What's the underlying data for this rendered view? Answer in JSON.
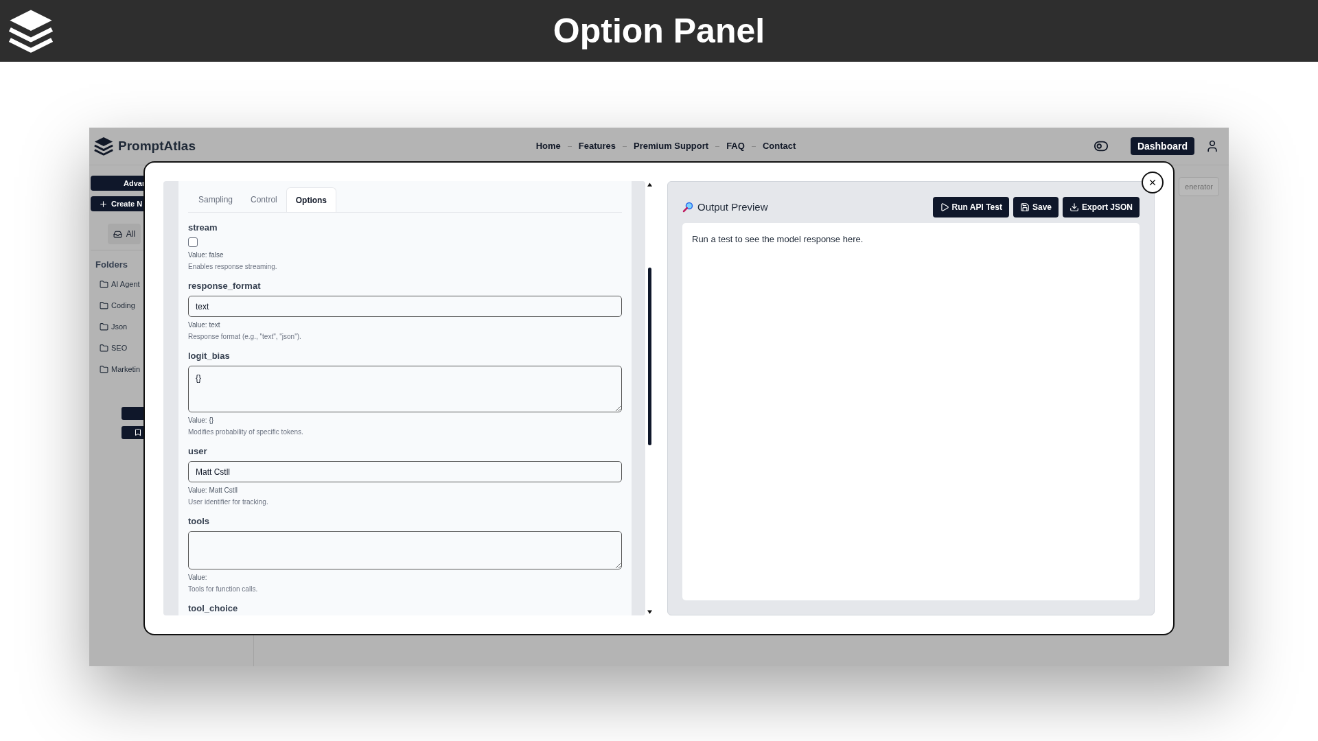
{
  "banner": {
    "title": "Option Panel"
  },
  "app": {
    "brand": "PromptAtlas",
    "nav": [
      "Home",
      "Features",
      "Premium Support",
      "FAQ",
      "Contact"
    ],
    "dashboard_button": "Dashboard",
    "generator_button": "enerator"
  },
  "sidebar": {
    "buttons": [
      "Advar",
      "Create N"
    ],
    "filter": "All",
    "folders_heading": "Folders",
    "folders": [
      "AI Agent",
      "Coding",
      "Json",
      "SEO",
      "Marketin"
    ]
  },
  "modal": {
    "tabs": [
      {
        "label": "Sampling",
        "selected": false
      },
      {
        "label": "Control",
        "selected": false
      },
      {
        "label": "Options",
        "selected": true
      }
    ],
    "fields": [
      {
        "kind": "checkbox",
        "name": "stream",
        "checked": false,
        "value_text": "Value: false",
        "description": "Enables response streaming."
      },
      {
        "kind": "input",
        "name": "response_format",
        "value": "text",
        "value_text": "Value: text",
        "description": "Response format (e.g., \"text\", \"json\")."
      },
      {
        "kind": "textarea",
        "name": "logit_bias",
        "value": "{}",
        "value_text": "Value: {}",
        "description": "Modifies probability of specific tokens."
      },
      {
        "kind": "input",
        "name": "user",
        "value": "Matt Cstll",
        "value_text": "Value: Matt Cstll",
        "description": "User identifier for tracking."
      },
      {
        "kind": "textarea-short",
        "name": "tools",
        "value_text": "Value:",
        "description": "Tools for function calls."
      },
      {
        "kind": "label",
        "name": "tool_choice"
      }
    ],
    "output": {
      "title": "Output Preview",
      "buttons": [
        {
          "label": "Run API Test",
          "kind": "play"
        },
        {
          "label": "Save",
          "kind": "save"
        },
        {
          "label": "Export JSON",
          "kind": "download"
        }
      ],
      "text": "Run a test to see the model response here."
    }
  }
}
